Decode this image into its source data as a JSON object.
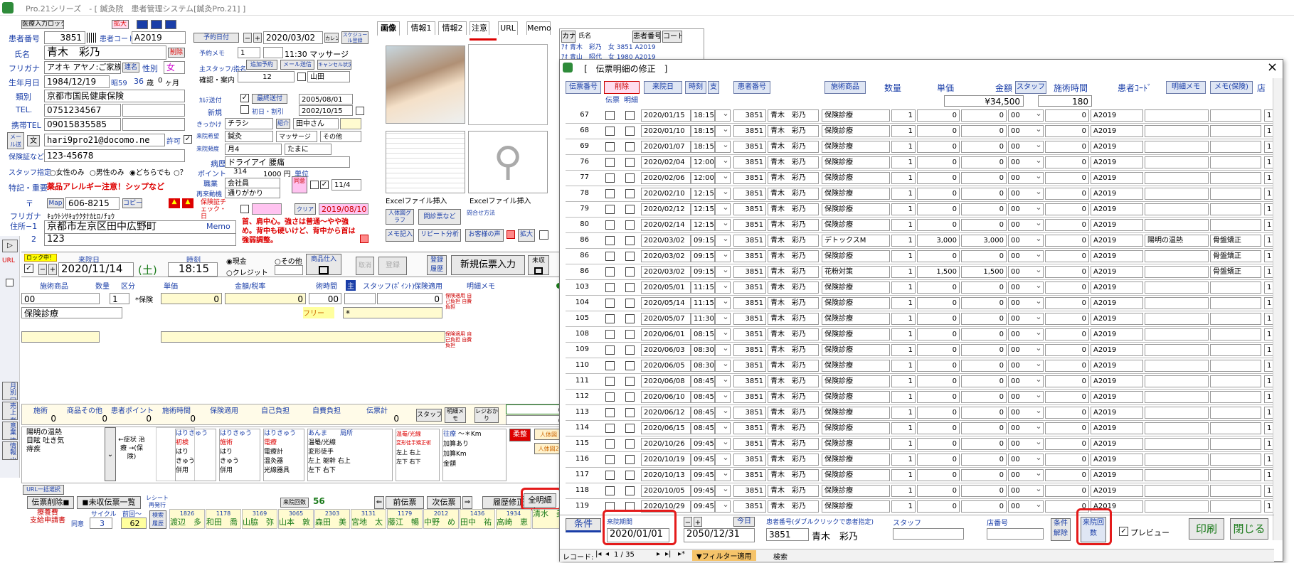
{
  "window": {
    "title": "Pro.21シリーズ　- [ 鍼灸院　患者管理システム[鍼灸Pro.21] ]"
  },
  "top": {
    "unlock_btn": "医療入力ロック",
    "enlarge": "拡大"
  },
  "patient": {
    "id_label": "患者番号",
    "id": "3851",
    "code_label": "患者コード",
    "code": "A2019",
    "name_label": "氏名",
    "name": "青木　彩乃",
    "delete": "削除",
    "kana_label": "フリガナ",
    "kana": "アオキ アヤノ:ご家族",
    "rename": "連名",
    "sex_label": "性別",
    "sex": "女",
    "birth_label": "生年月日",
    "birth": "1984/12/19",
    "era": "昭59",
    "age": "36",
    "age_unit": "歳",
    "months": "0",
    "months_unit": "ヶ月",
    "category_label": "類別",
    "insurer": "京都市国民健康保険",
    "tel_label": "TEL.",
    "tel": "0751234567",
    "mobile_label": "携帯TEL",
    "mobile": "09015835585",
    "mail_label": "メール送信",
    "mail_btn": "文",
    "email": "hari9pro21@docomo.ne",
    "permit": "許可",
    "ins_label": "保険証など",
    "ins_no": "123-45678",
    "staff_label": "スタッフ指定",
    "opt_female": "女性のみ",
    "opt_male": "男性のみ",
    "opt_any": "どちらでも",
    "opt_q": "？",
    "note_label": "特記・重要",
    "note": "薬品アレルギー注意！シップなど",
    "zip_label": "〒",
    "map": "Map",
    "zip": "606-8215",
    "copy": "コピー",
    "addr_kana_label": "フリガナ",
    "addr_kana": "ｷｮｳﾄｼｻｷｮｳｸﾀﾅｶﾋﾛﾉﾁｮｳ",
    "addr_label": "住所−1",
    "addr1": "京都市左京区田中広野町",
    "addr2_label": "2",
    "addr2": "123"
  },
  "appt": {
    "date_label": "予約日付",
    "date": "2020/03/02",
    "cal": "カレンダー",
    "sched": "スケジュール登録",
    "memo_label": "予約メモ",
    "memo_no": "1",
    "time_text": "11:30 マッサージ",
    "staff_label": "主スタッフ/指名",
    "staff_no": "12",
    "staff_name": "山田",
    "confirm": "確認・案内",
    "add_appt": "追加予約",
    "mail_send": "メール送信",
    "cancel_chk": "キャンセル状況",
    "kana_send_label": "ｶﾙﾃ送付",
    "latest_send": "最終送付",
    "latest_date": "2005/08/01",
    "new_label": "新規",
    "first_label": "初日・割引",
    "first_date": "2002/10/15",
    "trigger_label": "きっかけ",
    "trigger": "チラシ",
    "intro": "紹介",
    "intro_name": "田中さん",
    "menu_label": "来院希望",
    "menu1": "鍼灸",
    "menu2": "マッサージ",
    "menu3": "その他",
    "freq_label": "来院頻度",
    "freq": "月4",
    "freq2": "たまに",
    "disease_label": "病歴",
    "disease": "ドライアイ 腰痛",
    "point_label": "ポイント",
    "point": "314",
    "yen": "1000 円",
    "unit": "単位",
    "job_label": "職業",
    "job": "会社員",
    "reason_label": "再来動機",
    "reason": "通りがかり",
    "ins_check_label": "保険証チェック・日",
    "ins_check_date": "2019/08/10",
    "ins_end": "11/4",
    "symptom": "首、肩中心。強さは普通〜やや強め。背中も硬いけど、背中から首は強弱調整。"
  },
  "tabs": [
    "画像",
    "情報1",
    "情報2",
    "注意",
    "URL",
    "Memo"
  ],
  "imgpanel": {
    "excel1": "Excelファイル挿入",
    "excel2": "Excelファイル挿入",
    "b1": "人体図グラフ",
    "b2": "問診票など",
    "b3": "問合せ方法",
    "b4": "メモ記入",
    "b5": "リピート分析",
    "b6": "お客様の声",
    "b7": "拡大"
  },
  "visit": {
    "lock": "ロック中！",
    "date_label": "来院日",
    "date": "2020/11/14",
    "dow": "(土)",
    "time_label": "時刻",
    "time": "18:15",
    "cash": "現金",
    "other": "その他",
    "credit": "クレジット",
    "item_entry": "商品仕入",
    "btn_a": "取消",
    "btn_b": "登録",
    "btn_history": "登録履歴",
    "new_voucher": "新規伝票入力",
    "unpaid": "未収",
    "col_item": "施術商品",
    "col_qty": "数量",
    "col_kbn": "区分",
    "col_price": "単価",
    "col_amount": "金額/税率",
    "col_time": "術時間",
    "col_main": "主",
    "col_staff": "スタッフ(ﾎﾟｲﾝﾄ)",
    "col_ins": "保険適用",
    "col_memo": "明細メモ",
    "r1_item": "00",
    "r1_qty": "1",
    "r1_kbn": "*保険",
    "r1_price": "0",
    "r1_amount": "0",
    "r1_time": "0",
    "r1_time2": "00",
    "r1_staff": "0",
    "r2_item": "保険診療",
    "r2_free": "フリー",
    "r2_mark": "*",
    "ins_text": "保険適用 自己負担 自費負担"
  },
  "totals": {
    "labels": [
      "施術",
      "商品その他",
      "患者ポイント",
      "施術時間",
      "保険適用",
      "自己負担",
      "自費負担",
      "伝票計"
    ],
    "values": [
      "0",
      "0",
      "0",
      "0",
      "",
      "",
      "",
      "0"
    ],
    "staff": "スタッフ",
    "memo": "明細メモ",
    "receipt": "レジおかり",
    "r1": "0",
    "r2": "0"
  },
  "symptoms": {
    "text1": "陽明の温熱",
    "text2": "目眩 吐き気",
    "text3": "痔疾",
    "arrow": "←症状 治療 →(保険)",
    "g1": "はりきゅう",
    "g1a": "初検",
    "g1b": "はり",
    "g1c": "きゅう",
    "g1d": "併用",
    "g2": "はりきゅう",
    "g2a": "施術",
    "g3": "はりきゅう",
    "g3a": "電療",
    "g3b": "電療計",
    "g3c": "温灸器",
    "g3d": "光線器具",
    "g4": "あんま",
    "g4a": "温罨/光線",
    "g4b": "変形徒手",
    "g4c": "左上",
    "g4d": "左下",
    "g4e": "躯幹",
    "g4f": "右上",
    "g4g": "右下",
    "g4h": "局所",
    "g5": "温罨/光線",
    "g5a": "変形徒手矯正術",
    "g5b": "左上 右上",
    "g5c": "左下 右下",
    "g6": "往療",
    "g6a": "加算あり",
    "g6b": "加算Km",
    "g6c": "金額",
    "g6d": "〜＊Km",
    "g7": "柔整",
    "g7a": "人体図",
    "g7b": "人体図2"
  },
  "bottom": {
    "url": "URL一括選択",
    "del": "伝票削除",
    "unpaid_list": "未収伝票一覧",
    "receipt": "レシート 再発行",
    "visits_label": "来院回数",
    "visits": "56",
    "prev": "前伝票",
    "next": "次伝票",
    "hist": "履歴修正",
    "all": "全明細",
    "billing1": "療養費",
    "billing2": "支給申請書",
    "hdr": "同意",
    "cycle_label": "サイクル",
    "cycle": "3",
    "prev_label": "前回〜",
    "prev_val": "62",
    "search": "検索 履歴"
  },
  "patients_strip": [
    {
      "n": "1826",
      "name": "渡辺　多"
    },
    {
      "n": "1178",
      "name": "和田　喬"
    },
    {
      "n": "3169",
      "name": "山脇　弥"
    },
    {
      "n": "3065",
      "name": "山本　敦"
    },
    {
      "n": "2303",
      "name": "森田　美"
    },
    {
      "n": "3131",
      "name": "宮地　太"
    },
    {
      "n": "1179",
      "name": "藤江　暢"
    },
    {
      "n": "2012",
      "name": "中野　め"
    },
    {
      "n": "1436",
      "name": "田中　祐"
    },
    {
      "n": "1934",
      "name": "高崎　恵"
    },
    {
      "n": "",
      "name": "清水　美"
    }
  ],
  "sidebtns": [
    "月別 回数",
    "売上 業務",
    "意業 情報",
    "情報 出力"
  ],
  "bg_list": {
    "h1": "カナ",
    "h2": "氏名",
    "h3": "患者番号",
    "h4": "コード",
    "r1": "ｱｵ 青木　彩乃　女 3851 A2019",
    "r2": "ｱｵ 青山　昭代　女 1980 A2019"
  },
  "dialog": {
    "title": "[　伝票明細の修正　]",
    "close": "×",
    "h_voucher": "伝票番号",
    "h_delete": "削除",
    "h_visit": "来院日",
    "h_time": "時刻",
    "h_shi": "支",
    "h_patient": "患者番号",
    "h_item": "施術商品",
    "h_qty": "数量",
    "h_price": "単価",
    "h_amount": "金額",
    "h_staff": "スタッフ",
    "h_optime": "施術時間",
    "h_code": "患者ｺｰﾄﾞ",
    "h_memo": "明細メモ",
    "h_memoins": "メモ(保険)",
    "h_shop": "店",
    "sub_v": "伝票",
    "sub_m": "明細",
    "total_amount": "¥34,500",
    "total_time": "180",
    "rows": [
      {
        "no": "67",
        "date": "2020/01/15",
        "time": "18:15",
        "pid": "3851",
        "name": "青木　彩乃",
        "item": "保険診療",
        "qty": "1",
        "price": "0",
        "amount": "0",
        "staff": "00",
        "optime": "0",
        "code": "A2019",
        "memo": "",
        "memo2": ""
      },
      {
        "no": "68",
        "date": "2020/01/10",
        "time": "18:15",
        "pid": "3851",
        "name": "青木　彩乃",
        "item": "保険診療",
        "qty": "1",
        "price": "0",
        "amount": "0",
        "staff": "00",
        "optime": "0",
        "code": "A2019",
        "memo": "",
        "memo2": ""
      },
      {
        "no": "69",
        "date": "2020/01/07",
        "time": "18:15",
        "pid": "3851",
        "name": "青木　彩乃",
        "item": "保険診療",
        "qty": "1",
        "price": "0",
        "amount": "0",
        "staff": "00",
        "optime": "0",
        "code": "A2019",
        "memo": "",
        "memo2": ""
      },
      {
        "no": "76",
        "date": "2020/02/04",
        "time": "12:00",
        "pid": "3851",
        "name": "青木　彩乃",
        "item": "保険診療",
        "qty": "1",
        "price": "0",
        "amount": "0",
        "staff": "00",
        "optime": "0",
        "code": "A2019",
        "memo": "",
        "memo2": ""
      },
      {
        "no": "77",
        "date": "2020/02/06",
        "time": "12:00",
        "pid": "3851",
        "name": "青木　彩乃",
        "item": "保険診療",
        "qty": "1",
        "price": "0",
        "amount": "0",
        "staff": "00",
        "optime": "0",
        "code": "A2019",
        "memo": "",
        "memo2": ""
      },
      {
        "no": "78",
        "date": "2020/02/10",
        "time": "12:15",
        "pid": "3851",
        "name": "青木　彩乃",
        "item": "保険診療",
        "qty": "1",
        "price": "0",
        "amount": "0",
        "staff": "00",
        "optime": "0",
        "code": "A2019",
        "memo": "",
        "memo2": ""
      },
      {
        "no": "79",
        "date": "2020/02/12",
        "time": "12:15",
        "pid": "3851",
        "name": "青木　彩乃",
        "item": "保険診療",
        "qty": "1",
        "price": "0",
        "amount": "0",
        "staff": "00",
        "optime": "0",
        "code": "A2019",
        "memo": "",
        "memo2": ""
      },
      {
        "no": "80",
        "date": "2020/02/14",
        "time": "12:15",
        "pid": "3851",
        "name": "青木　彩乃",
        "item": "保険診療",
        "qty": "1",
        "price": "0",
        "amount": "0",
        "staff": "00",
        "optime": "0",
        "code": "A2019",
        "memo": "",
        "memo2": ""
      },
      {
        "no": "86",
        "date": "2020/03/02",
        "time": "09:15",
        "pid": "3851",
        "name": "青木　彩乃",
        "item": "デトックスM",
        "qty": "1",
        "price": "3,000",
        "amount": "3,000",
        "staff": "00",
        "optime": "0",
        "code": "A2019",
        "memo": "陽明の温熱",
        "memo2": "骨盤矯正"
      },
      {
        "no": "86",
        "date": "2020/03/02",
        "time": "09:15",
        "pid": "3851",
        "name": "青木　彩乃",
        "item": "保険診療",
        "qty": "1",
        "price": "0",
        "amount": "0",
        "staff": "00",
        "optime": "0",
        "code": "A2019",
        "memo": "",
        "memo2": "骨盤矯正"
      },
      {
        "no": "86",
        "date": "2020/03/02",
        "time": "09:15",
        "pid": "3851",
        "name": "青木　彩乃",
        "item": "花粉対策",
        "qty": "1",
        "price": "1,500",
        "amount": "1,500",
        "staff": "00",
        "optime": "0",
        "code": "A2019",
        "memo": "",
        "memo2": "骨盤矯正"
      },
      {
        "no": "103",
        "date": "2020/05/01",
        "time": "11:15",
        "pid": "3851",
        "name": "青木　彩乃",
        "item": "保険診療",
        "qty": "1",
        "price": "0",
        "amount": "0",
        "staff": "00",
        "optime": "0",
        "code": "A2019",
        "memo": "",
        "memo2": ""
      },
      {
        "no": "104",
        "date": "2020/05/14",
        "time": "11:15",
        "pid": "3851",
        "name": "青木　彩乃",
        "item": "保険診療",
        "qty": "1",
        "price": "0",
        "amount": "0",
        "staff": "00",
        "optime": "0",
        "code": "A2019",
        "memo": "",
        "memo2": ""
      },
      {
        "no": "105",
        "date": "2020/05/07",
        "time": "11:30",
        "pid": "3851",
        "name": "青木　彩乃",
        "item": "保険診療",
        "qty": "1",
        "price": "0",
        "amount": "0",
        "staff": "00",
        "optime": "0",
        "code": "A2019",
        "memo": "",
        "memo2": ""
      },
      {
        "no": "108",
        "date": "2020/06/01",
        "time": "08:15",
        "pid": "3851",
        "name": "青木　彩乃",
        "item": "保険診療",
        "qty": "1",
        "price": "0",
        "amount": "0",
        "staff": "00",
        "optime": "0",
        "code": "A2019",
        "memo": "",
        "memo2": ""
      },
      {
        "no": "109",
        "date": "2020/06/03",
        "time": "08:30",
        "pid": "3851",
        "name": "青木　彩乃",
        "item": "保険診療",
        "qty": "1",
        "price": "0",
        "amount": "0",
        "staff": "00",
        "optime": "0",
        "code": "A2019",
        "memo": "",
        "memo2": ""
      },
      {
        "no": "110",
        "date": "2020/06/05",
        "time": "08:30",
        "pid": "3851",
        "name": "青木　彩乃",
        "item": "保険診療",
        "qty": "1",
        "price": "0",
        "amount": "0",
        "staff": "00",
        "optime": "0",
        "code": "A2019",
        "memo": "",
        "memo2": ""
      },
      {
        "no": "111",
        "date": "2020/06/08",
        "time": "08:45",
        "pid": "3851",
        "name": "青木　彩乃",
        "item": "保険診療",
        "qty": "1",
        "price": "0",
        "amount": "0",
        "staff": "00",
        "optime": "0",
        "code": "A2019",
        "memo": "",
        "memo2": ""
      },
      {
        "no": "112",
        "date": "2020/06/10",
        "time": "08:45",
        "pid": "3851",
        "name": "青木　彩乃",
        "item": "保険診療",
        "qty": "1",
        "price": "0",
        "amount": "0",
        "staff": "00",
        "optime": "0",
        "code": "A2019",
        "memo": "",
        "memo2": ""
      },
      {
        "no": "113",
        "date": "2020/06/12",
        "time": "08:45",
        "pid": "3851",
        "name": "青木　彩乃",
        "item": "保険診療",
        "qty": "1",
        "price": "0",
        "amount": "0",
        "staff": "00",
        "optime": "0",
        "code": "A2019",
        "memo": "",
        "memo2": ""
      },
      {
        "no": "114",
        "date": "2020/06/15",
        "time": "08:45",
        "pid": "3851",
        "name": "青木　彩乃",
        "item": "保険診療",
        "qty": "1",
        "price": "0",
        "amount": "0",
        "staff": "00",
        "optime": "0",
        "code": "A2019",
        "memo": "",
        "memo2": ""
      },
      {
        "no": "115",
        "date": "2020/10/26",
        "time": "09:45",
        "pid": "3851",
        "name": "青木　彩乃",
        "item": "保険診療",
        "qty": "1",
        "price": "0",
        "amount": "0",
        "staff": "00",
        "optime": "0",
        "code": "A2019",
        "memo": "",
        "memo2": ""
      },
      {
        "no": "116",
        "date": "2020/10/19",
        "time": "09:45",
        "pid": "3851",
        "name": "青木　彩乃",
        "item": "保険診療",
        "qty": "1",
        "price": "0",
        "amount": "0",
        "staff": "00",
        "optime": "0",
        "code": "A2019",
        "memo": "",
        "memo2": ""
      },
      {
        "no": "117",
        "date": "2020/10/13",
        "time": "09:45",
        "pid": "3851",
        "name": "青木　彩乃",
        "item": "保険診療",
        "qty": "1",
        "price": "0",
        "amount": "0",
        "staff": "00",
        "optime": "0",
        "code": "A2019",
        "memo": "",
        "memo2": ""
      },
      {
        "no": "118",
        "date": "2020/10/05",
        "time": "09:45",
        "pid": "3851",
        "name": "青木　彩乃",
        "item": "保険診療",
        "qty": "1",
        "price": "0",
        "amount": "0",
        "staff": "00",
        "optime": "0",
        "code": "A2019",
        "memo": "",
        "memo2": ""
      },
      {
        "no": "119",
        "date": "2020/10/29",
        "time": "09:45",
        "pid": "3851",
        "name": "青木　彩乃",
        "item": "保険診療",
        "qty": "1",
        "price": "0",
        "amount": "0",
        "staff": "00",
        "optime": "0",
        "code": "A2019",
        "memo": "",
        "memo2": ""
      }
    ],
    "shop_val": "1",
    "footer": {
      "cond": "条件",
      "from_label": "来院期間",
      "from": "2020/01/01",
      "to": "2050/12/31",
      "today": "今日",
      "pno_label": "患者番号(ダブルクリックで患者指定)",
      "pno": "3851",
      "pname": "青木　彩乃",
      "staff_label": "スタッフ",
      "shop_label": "店番号",
      "clear": "条件解除",
      "visits": "来院回数",
      "preview": "プレビュー",
      "print": "印刷",
      "close": "閉じる"
    },
    "nav": {
      "label": "レコード:",
      "pos": "1 / 35",
      "filter": "フィルター適用",
      "search": "検索"
    }
  }
}
